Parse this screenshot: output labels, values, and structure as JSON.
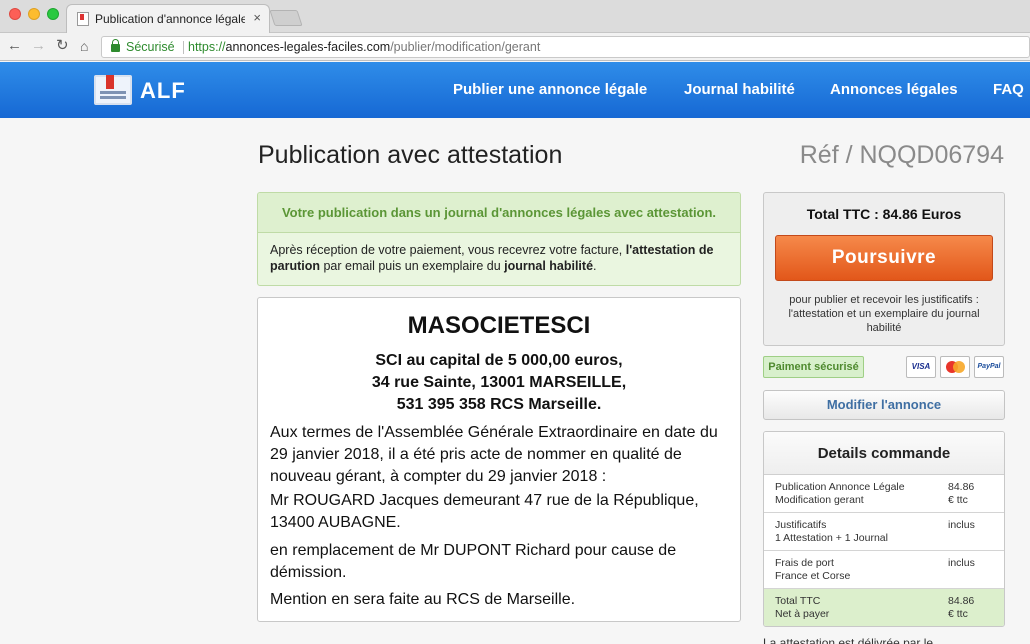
{
  "browser": {
    "tab_title": "Publication d'annonce légale d",
    "tab_close": "×",
    "secure_label": "Sécurisé",
    "url_scheme": "https://",
    "url_domain": "annonces-legales-faciles.com",
    "url_path": "/publier/modification/gerant"
  },
  "site": {
    "logo_text": "ALF",
    "nav": [
      "Publier une annonce légale",
      "Journal habilité",
      "Annonces légales",
      "FAQ"
    ]
  },
  "page": {
    "title": "Publication avec attestation",
    "ref": "Réf / NQQD06794"
  },
  "notice": {
    "headline": "Votre publication dans un journal d'annonces légales avec attestation.",
    "body_1": "Après réception de votre paiement, vous recevrez votre facture, ",
    "body_bold_1": "l'attestation de parution",
    "body_2": " par email puis un exemplaire du ",
    "body_bold_2": "journal habilité",
    "body_3": "."
  },
  "annonce": {
    "company": "MASOCIETESCI",
    "capital": "SCI au capital de 5 000,00 euros,",
    "address": "34 rue Sainte, 13001 MARSEILLE,",
    "rcs": "531 395 358 RCS Marseille.",
    "paragraphs": [
      "Aux termes de l'Assemblée Générale Extraordinaire en date du 29 janvier 2018, il a été pris acte de nommer en qualité de nouveau gérant, à compter du 29 janvier 2018 :",
      "Mr ROUGARD Jacques demeurant 47 rue de la République, 13400 AUBAGNE.",
      "en remplacement de Mr DUPONT Richard pour cause de démission.",
      "Mention en sera faite au RCS de Marseille."
    ]
  },
  "sidebar": {
    "total": "Total TTC : 84.86 Euros",
    "continue_label": "Poursuivre",
    "continue_note": "pour publier et recevoir les justificatifs : l'attestation et un exemplaire du journal habilité",
    "secure_payment": "Paiment sécurisé",
    "cards": [
      "VISA",
      "PayPal"
    ],
    "modify_label": "Modifier l'annonce",
    "details_title": "Details commande",
    "details": [
      {
        "label_1": "Publication Annonce Légale",
        "label_2": "Modification gerant",
        "amount_1": "84.86",
        "amount_2": "€ ttc"
      },
      {
        "label_1": "Justificatifs",
        "label_2": "1 Attestation + 1 Journal",
        "amount_1": "inclus",
        "amount_2": ""
      },
      {
        "label_1": "Frais de port",
        "label_2": "France et Corse",
        "amount_1": "inclus",
        "amount_2": ""
      },
      {
        "label_1": "Total TTC",
        "label_2": "Net à payer",
        "amount_1": "84.86",
        "amount_2": "€ ttc"
      }
    ],
    "cut_text": "La attestation est délivrée par le"
  }
}
